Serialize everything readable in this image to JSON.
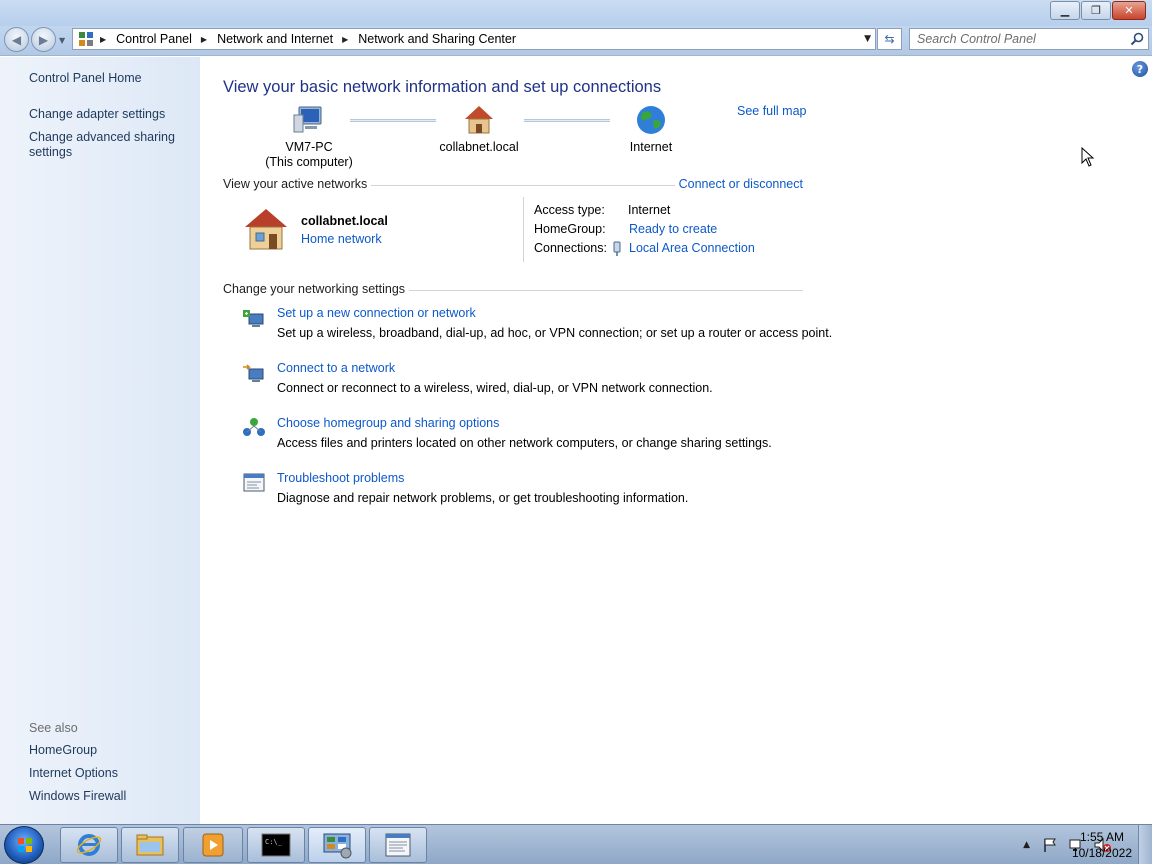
{
  "window": {
    "minimize_icon": "minimize-icon",
    "maximize_icon": "restore-icon",
    "close_icon": "close-icon"
  },
  "address": {
    "breadcrumbs": [
      "Control Panel",
      "Network and Internet",
      "Network and Sharing Center"
    ],
    "search_placeholder": "Search Control Panel"
  },
  "sidebar": {
    "home": "Control Panel Home",
    "links": [
      "Change adapter settings",
      "Change advanced sharing settings"
    ],
    "see_also_label": "See also",
    "see_also": [
      "HomeGroup",
      "Internet Options",
      "Windows Firewall"
    ]
  },
  "main": {
    "title": "View your basic network information and set up connections",
    "see_full_map": "See full map",
    "map": {
      "computer_name": "VM7-PC",
      "computer_sub": "(This computer)",
      "network": "collabnet.local",
      "internet": "Internet"
    },
    "active_networks": {
      "label": "View your active networks",
      "connect_link": "Connect or disconnect",
      "network_name": "collabnet.local",
      "network_type": "Home network",
      "access_type_label": "Access type:",
      "access_type_value": "Internet",
      "homegroup_label": "HomeGroup:",
      "homegroup_value": "Ready to create",
      "connections_label": "Connections:",
      "connections_value": "Local Area Connection"
    },
    "settings": {
      "label": "Change your networking settings",
      "tasks": [
        {
          "title": "Set up a new connection or network",
          "desc": "Set up a wireless, broadband, dial-up, ad hoc, or VPN connection; or set up a router or access point."
        },
        {
          "title": "Connect to a network",
          "desc": "Connect or reconnect to a wireless, wired, dial-up, or VPN network connection."
        },
        {
          "title": "Choose homegroup and sharing options",
          "desc": "Access files and printers located on other network computers, or change sharing settings."
        },
        {
          "title": "Troubleshoot problems",
          "desc": "Diagnose and repair network problems, or get troubleshooting information."
        }
      ]
    }
  },
  "taskbar": {
    "time": "1:55 AM",
    "date": "10/18/2022",
    "apps": [
      "internet-explorer-icon",
      "windows-explorer-icon",
      "media-player-icon",
      "command-prompt-icon",
      "control-panel-icon",
      "document-viewer-icon"
    ]
  }
}
